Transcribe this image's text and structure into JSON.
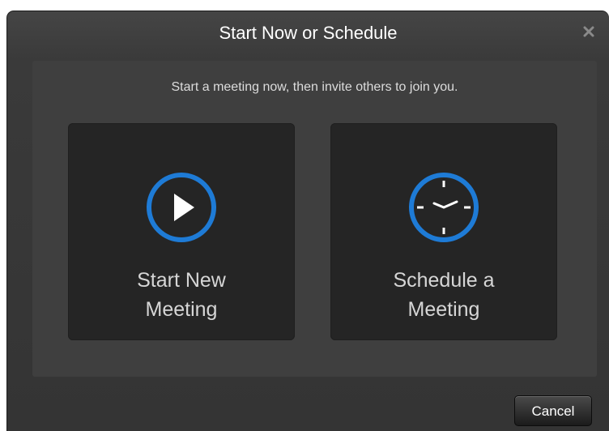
{
  "dialog": {
    "title": "Start Now or Schedule",
    "close_icon": "close-icon",
    "subtitle": "Start a meeting now, then invite others to join you.",
    "options": [
      {
        "label_line1": "Start New",
        "label_line2": "Meeting",
        "icon": "play-icon"
      },
      {
        "label_line1": "Schedule a",
        "label_line2": "Meeting",
        "icon": "clock-icon"
      }
    ],
    "cancel_label": "Cancel"
  },
  "colors": {
    "accent": "#1e7bd6",
    "background": "#343434",
    "panel": "#3f3f3f",
    "tile": "#252525",
    "text": "#d6d6d6"
  }
}
